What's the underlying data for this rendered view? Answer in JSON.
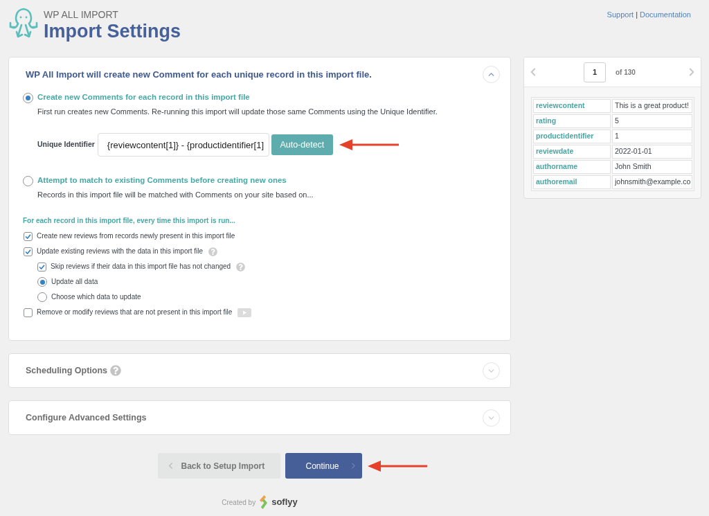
{
  "header": {
    "brand": "WP ALL IMPORT",
    "title": "Import Settings",
    "links": [
      {
        "label": "Support"
      },
      {
        "label": "Documentation"
      }
    ],
    "separator": "|"
  },
  "import_panel": {
    "title": "WP All Import will create new Comment for each unique record in this import file.",
    "expanded": true,
    "modes": [
      {
        "label": "Create new Comments for each record in this import file",
        "description": "First run creates new Comments. Re-running this import will update those same Comments using the Unique Identifier.",
        "selected": true,
        "unique_identifier": {
          "label": "Unique Identifier",
          "value": "{reviewcontent[1]} - {productidentifier[1]",
          "button": "Auto-detect"
        }
      },
      {
        "label": "Attempt to match to existing Comments before creating new ones",
        "description": "Records in this import file will be matched with Comments on your site based on...",
        "selected": false
      }
    ],
    "options_heading": "For each record in this import file, every time this import is run...",
    "options": [
      {
        "kind": "checkbox",
        "label": "Create new reviews from records newly present in this import file",
        "checked": true,
        "help": false,
        "video": false
      },
      {
        "kind": "checkbox",
        "label": "Update existing reviews with the data in this import file",
        "checked": true,
        "help": true,
        "video": false,
        "children": [
          {
            "kind": "checkbox",
            "label": "Skip reviews if their data in this import file has not changed",
            "checked": true,
            "help": true,
            "video": false
          },
          {
            "kind": "radio",
            "label": "Update all data",
            "selected": true,
            "help": false,
            "video": false
          },
          {
            "kind": "radio",
            "label": "Choose which data to update",
            "selected": false,
            "help": false,
            "video": false
          }
        ]
      },
      {
        "kind": "checkbox",
        "label": "Remove or modify reviews that are not present in this import file",
        "checked": false,
        "help": false,
        "video": true
      }
    ]
  },
  "sections": [
    {
      "title": "Scheduling Options",
      "help": true,
      "expanded": false
    },
    {
      "title": "Configure Advanced Settings",
      "help": false,
      "expanded": false
    }
  ],
  "footer": {
    "buttons": [
      {
        "kind": "back",
        "label": "Back to Setup Import"
      },
      {
        "kind": "continue",
        "label": "Continue"
      }
    ],
    "credit": "Created by",
    "brand": "soflyy"
  },
  "preview": {
    "page": "1",
    "total": "of 130",
    "record": [
      {
        "field": "reviewcontent",
        "value": "This is a great product!"
      },
      {
        "field": "rating",
        "value": "5"
      },
      {
        "field": "productidentifier",
        "value": "1"
      },
      {
        "field": "reviewdate",
        "value": "2022-01-01"
      },
      {
        "field": "authorname",
        "value": "John Smith"
      },
      {
        "field": "authoremail",
        "value": "johnsmith@example.co"
      }
    ]
  }
}
